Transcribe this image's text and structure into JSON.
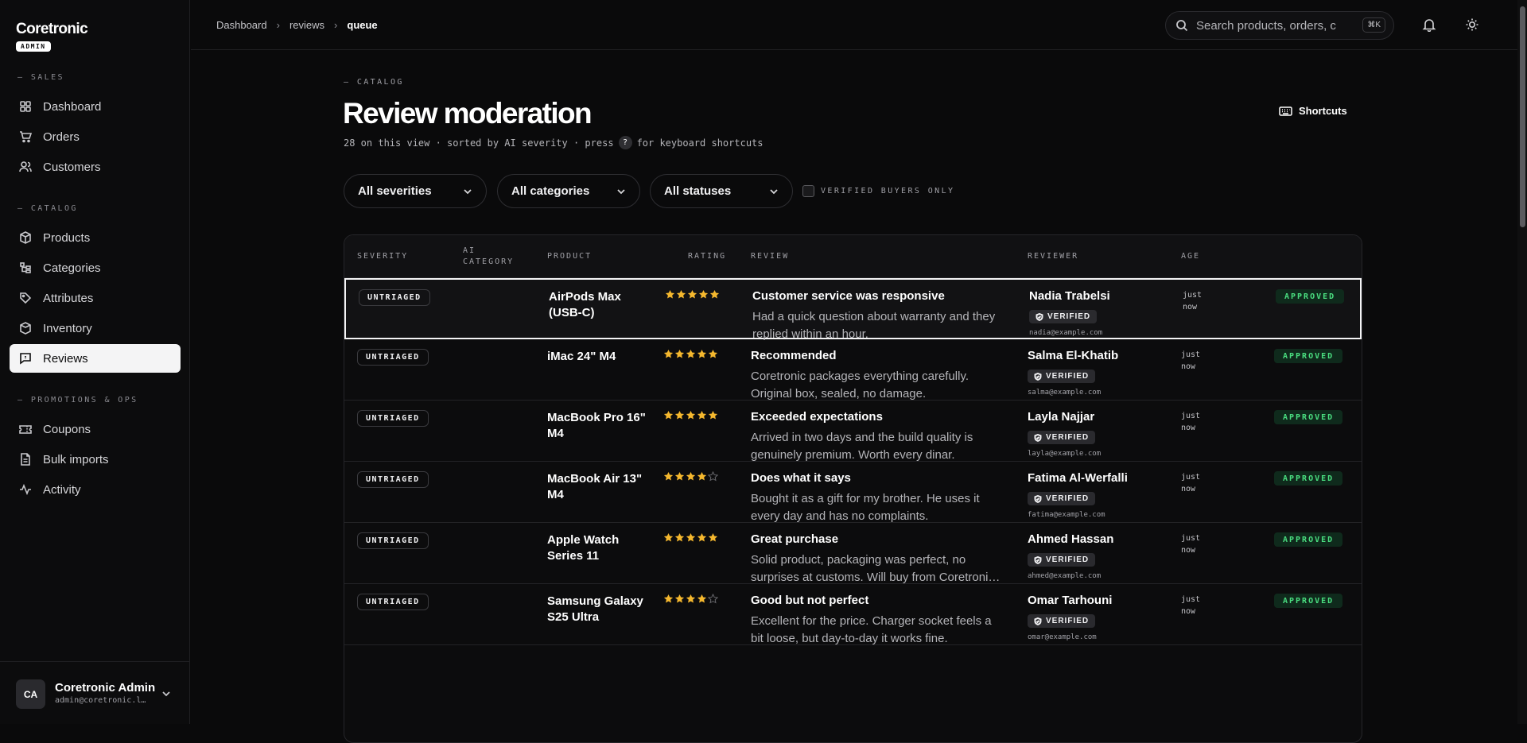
{
  "brand": {
    "name": "Coretronic",
    "badge": "ADMIN"
  },
  "nav": {
    "sections": [
      "SALES",
      "CATALOG",
      "PROMOTIONS & OPS"
    ],
    "items": [
      {
        "label": "Dashboard",
        "icon": "dashboard-icon"
      },
      {
        "label": "Orders",
        "icon": "cart-icon"
      },
      {
        "label": "Customers",
        "icon": "users-icon"
      },
      {
        "label": "Products",
        "icon": "box-icon"
      },
      {
        "label": "Categories",
        "icon": "categories-icon"
      },
      {
        "label": "Attributes",
        "icon": "tag-icon"
      },
      {
        "label": "Inventory",
        "icon": "inventory-icon"
      },
      {
        "label": "Reviews",
        "icon": "message-icon",
        "active": true
      },
      {
        "label": "Coupons",
        "icon": "ticket-icon"
      },
      {
        "label": "Bulk imports",
        "icon": "file-icon"
      },
      {
        "label": "Activity",
        "icon": "activity-icon"
      }
    ]
  },
  "user": {
    "initials": "CA",
    "name": "Coretronic Admin",
    "email": "admin@coretronic.lo..."
  },
  "breadcrumb": [
    "Dashboard",
    "reviews",
    "queue"
  ],
  "search": {
    "placeholder": "Search products, orders, c",
    "shortcut": "⌘K"
  },
  "page": {
    "eyebrow": "— CATALOG",
    "title": "Review moderation",
    "subtitle_before": "28 on this view · sorted by AI severity · press",
    "subtitle_key": "?",
    "subtitle_after": "for keyboard shortcuts",
    "shortcuts_label": "Shortcuts"
  },
  "filters": {
    "severity": "All severities",
    "category": "All categories",
    "status": "All statuses",
    "verified_only": "VERIFIED BUYERS ONLY"
  },
  "table": {
    "headers": {
      "severity": "SEVERITY",
      "ai_category_1": "AI",
      "ai_category_2": "CATEGORY",
      "product": "PRODUCT",
      "rating": "RATING",
      "review": "REVIEW",
      "reviewer": "REVIEWER",
      "age": "AGE"
    },
    "verified_label": "VERIFIED",
    "rows": [
      {
        "severity": "UNTRIAGED",
        "product": "AirPods Max (USB-C)",
        "rating": 5,
        "title": "Customer service was responsive",
        "body": "Had a quick question about warranty and they replied within an hour.",
        "name": "Nadia Trabelsi",
        "email": "nadia@example.com",
        "age1": "just",
        "age2": "now",
        "status": "APPROVED"
      },
      {
        "severity": "UNTRIAGED",
        "product": "iMac 24\" M4",
        "rating": 5,
        "title": "Recommended",
        "body": "Coretronic packages everything carefully. Original box, sealed, no damage.",
        "name": "Salma El-Khatib",
        "email": "salma@example.com",
        "age1": "just",
        "age2": "now",
        "status": "APPROVED"
      },
      {
        "severity": "UNTRIAGED",
        "product": "MacBook Pro 16\" M4",
        "rating": 5,
        "title": "Exceeded expectations",
        "body": "Arrived in two days and the build quality is genuinely premium. Worth every dinar.",
        "name": "Layla Najjar",
        "email": "layla@example.com",
        "age1": "just",
        "age2": "now",
        "status": "APPROVED"
      },
      {
        "severity": "UNTRIAGED",
        "product": "MacBook Air 13\" M4",
        "rating": 4,
        "title": "Does what it says",
        "body": "Bought it as a gift for my brother. He uses it every day and has no complaints.",
        "name": "Fatima Al-Werfalli",
        "email": "fatima@example.com",
        "age1": "just",
        "age2": "now",
        "status": "APPROVED"
      },
      {
        "severity": "UNTRIAGED",
        "product": "Apple Watch Series 11",
        "rating": 5,
        "title": "Great purchase",
        "body": "Solid product, packaging was perfect, no surprises at customs. Will buy from Coretroni…",
        "name": "Ahmed Hassan",
        "email": "ahmed@example.com",
        "age1": "just",
        "age2": "now",
        "status": "APPROVED"
      },
      {
        "severity": "UNTRIAGED",
        "product": "Samsung Galaxy S25 Ultra",
        "rating": 4,
        "title": "Good but not perfect",
        "body": "Excellent for the price. Charger socket feels a bit loose, but day-to-day it works fine.",
        "name": "Omar Tarhouni",
        "email": "omar@example.com",
        "age1": "just",
        "age2": "now",
        "status": "APPROVED"
      }
    ]
  },
  "colors": {
    "accent_star": "#f5b82e",
    "approved_text": "#4ade80",
    "approved_bg": "#0f2a1c"
  }
}
